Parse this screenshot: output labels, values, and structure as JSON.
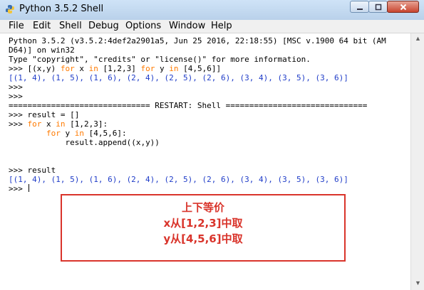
{
  "window": {
    "title": "Python 3.5.2 Shell",
    "icon": "python-icon",
    "controls": {
      "minimize": "−",
      "maximize": "□",
      "close": "✕"
    }
  },
  "menu": [
    "File",
    "Edit",
    "Shell",
    "Debug",
    "Options",
    "Window",
    "Help"
  ],
  "shell": {
    "banner1": "Python 3.5.2 (v3.5.2:4def2a2901a5, Jun 25 2016, 22:18:55) [MSC v.1900 64 bit (AM",
    "banner2": "D64)] on win32",
    "banner3": "Type \"copyright\", \"credits\" or \"license()\" for more information.",
    "prompt": ">>> ",
    "cmd1": {
      "a": "[(x,y) ",
      "b": "for",
      "c": " x ",
      "d": "in",
      "e": " [1,2,3] ",
      "f": "for",
      "g": " y ",
      "h": "in",
      "i": " [4,5,6]]"
    },
    "output1": "[(1, 4), (1, 5), (1, 6), (2, 4), (2, 5), (2, 6), (3, 4), (3, 5), (3, 6)]",
    "restart": "============================== RESTART: Shell ==============================",
    "cmd2": "result = []",
    "cmd3": {
      "a": "for",
      "b": " x ",
      "c": "in",
      "d": " [1,2,3]:"
    },
    "cmd4": {
      "indent": "    ",
      "a": "for",
      "b": " y ",
      "c": "in",
      "d": " [4,5,6]:"
    },
    "cmd5": "        result.append((x,y))",
    "cmd6": "result",
    "output2": "[(1, 4), (1, 5), (1, 6), (2, 4), (2, 5), (2, 6), (3, 4), (3, 5), (3, 6)]"
  },
  "note": {
    "line1": "上下等价",
    "line2": "x从[1,2,3]中取",
    "line3": "y从[4,5,6]中取",
    "color": "#d9342b"
  },
  "colors": {
    "output": "#1f3cc8",
    "keyword": "#ff7a00",
    "titlebar": "#c4daf1"
  }
}
